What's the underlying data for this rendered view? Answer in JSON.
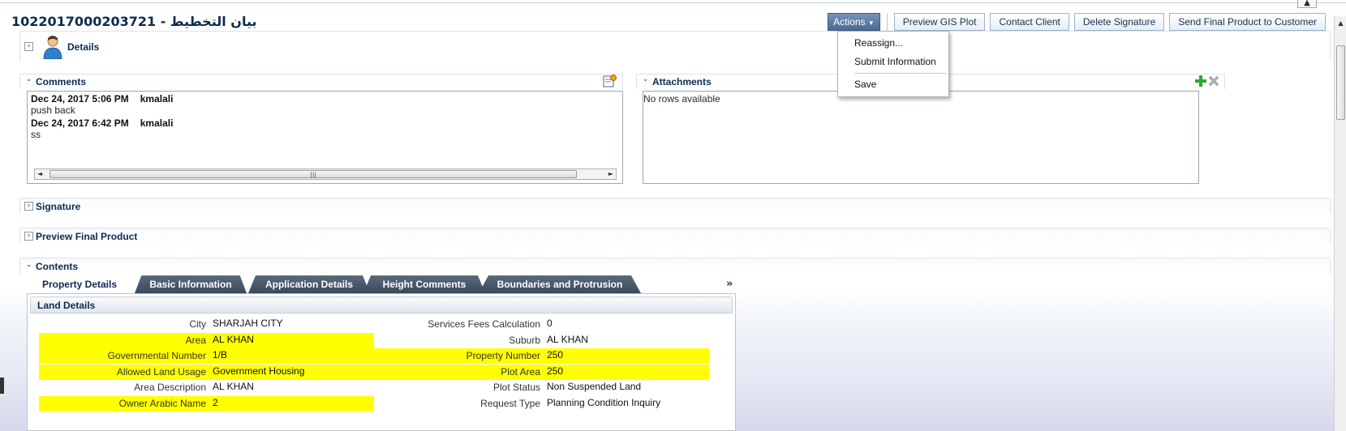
{
  "title": "1022017000203721 - بيان التخطيط",
  "toolbar": {
    "actions_label": "Actions",
    "buttons": [
      "Preview GIS Plot",
      "Contact Client",
      "Delete Signature",
      "Send Final Product to Customer"
    ]
  },
  "actions_menu": {
    "items": [
      "Reassign...",
      "Submit Information",
      "Save"
    ]
  },
  "sections": {
    "details": "Details",
    "comments": "Comments",
    "attachments": "Attachments",
    "signature": "Signature",
    "preview_final_product": "Preview Final Product",
    "contents": "Contents"
  },
  "comments": [
    {
      "date": "Dec 24, 2017 5:06 PM",
      "user": "kmalali",
      "text": "push back"
    },
    {
      "date": "Dec 24, 2017 6:42 PM",
      "user": "kmalali",
      "text": "ss"
    }
  ],
  "attachments": {
    "empty_text": "No rows available"
  },
  "tabs": [
    "Property Details",
    "Basic Information",
    "Application Details",
    "Height Comments",
    "Boundaries and Protrusion"
  ],
  "tabs_overflow": "»",
  "land_details": {
    "title": "Land Details",
    "left": [
      {
        "label": "City",
        "value": "SHARJAH CITY",
        "highlight": false
      },
      {
        "label": "Area",
        "value": "AL KHAN",
        "highlight": true
      },
      {
        "label": "Governmental Number",
        "value": "1/B",
        "highlight": true
      },
      {
        "label": "Allowed Land Usage",
        "value": "Government Housing",
        "highlight": true
      },
      {
        "label": "Area Description",
        "value": "AL KHAN",
        "highlight": false
      },
      {
        "label": "Owner Arabic Name",
        "value": "2",
        "highlight": true
      }
    ],
    "right": [
      {
        "label": "Services Fees Calculation",
        "value": "0",
        "highlight": false
      },
      {
        "label": "Suburb",
        "value": "AL KHAN",
        "highlight": false
      },
      {
        "label": "Property Number",
        "value": "250",
        "highlight": true
      },
      {
        "label": "Plot Area",
        "value": "250",
        "highlight": true
      },
      {
        "label": "Plot Status",
        "value": "Non Suspended Land",
        "highlight": false
      },
      {
        "label": "Request Type",
        "value": "Planning Condition Inquiry",
        "highlight": false
      }
    ]
  },
  "colors": {
    "highlight": "#ffff00",
    "accent": "#0b2c4f",
    "actions_button": "#4b6b95"
  }
}
